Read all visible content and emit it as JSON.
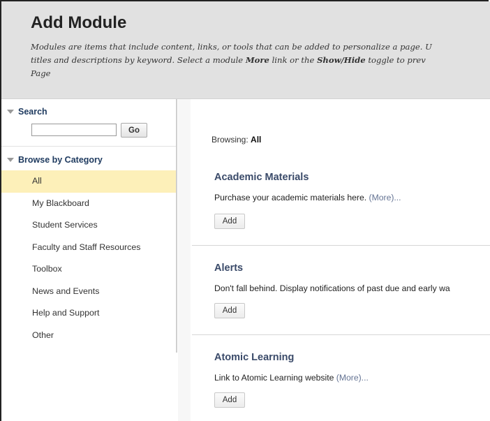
{
  "header": {
    "title": "Add Module",
    "description_line1": "Modules are items that include content, links, or tools that can be added to personalize a page. U",
    "description_line2_pre": "titles and descriptions by keyword. Select a module ",
    "description_line2_more": "More",
    "description_line2_mid": " link or the ",
    "description_line2_showhide": "Show/Hide",
    "description_line2_post": " toggle to prev",
    "description_line3": "Page"
  },
  "sidebar": {
    "search_heading": "Search",
    "search_value": "",
    "go_label": "Go",
    "browse_heading": "Browse by Category",
    "categories": [
      {
        "label": "All",
        "selected": true
      },
      {
        "label": "My Blackboard",
        "selected": false
      },
      {
        "label": "Student Services",
        "selected": false
      },
      {
        "label": "Faculty and Staff Resources",
        "selected": false
      },
      {
        "label": "Toolbox",
        "selected": false
      },
      {
        "label": "News and Events",
        "selected": false
      },
      {
        "label": "Help and Support",
        "selected": false
      },
      {
        "label": "Other",
        "selected": false
      }
    ]
  },
  "main": {
    "browsing_label": "Browsing: ",
    "browsing_value": "All",
    "modules": [
      {
        "title": "Academic Materials",
        "description": "Purchase your academic materials here.  ",
        "more": "(More)...",
        "add_label": "Add"
      },
      {
        "title": "Alerts",
        "description": "Don't fall behind. Display notifications of past due and early wa",
        "more": "",
        "add_label": "Add"
      },
      {
        "title": "Atomic Learning",
        "description": "Link to Atomic Learning website  ",
        "more": "(More)...",
        "add_label": "Add"
      }
    ]
  },
  "colors": {
    "header_bg": "#e1e1e1",
    "selected_bg": "#fdf0b9",
    "module_title": "#3a4a69",
    "more_link": "#647393"
  }
}
